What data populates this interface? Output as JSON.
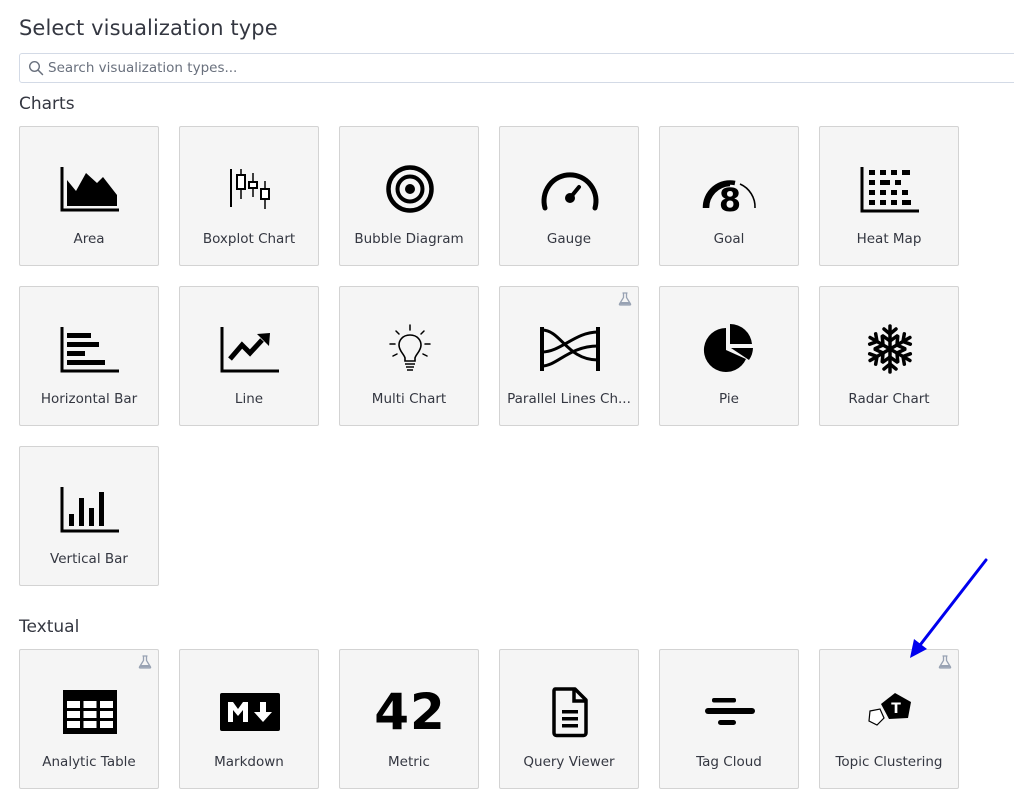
{
  "header": {
    "title": "Select visualization type"
  },
  "search": {
    "placeholder": "Search visualization types...",
    "value": ""
  },
  "sections": {
    "charts": {
      "title": "Charts",
      "tiles": [
        {
          "label": "Area",
          "icon": "area-chart-icon"
        },
        {
          "label": "Boxplot Chart",
          "icon": "boxplot-chart-icon"
        },
        {
          "label": "Bubble Diagram",
          "icon": "bubble-diagram-icon"
        },
        {
          "label": "Gauge",
          "icon": "gauge-icon"
        },
        {
          "label": "Goal",
          "icon": "goal-icon",
          "glyph": "8"
        },
        {
          "label": "Heat Map",
          "icon": "heat-map-icon"
        },
        {
          "label": "Horizontal Bar",
          "icon": "horizontal-bar-icon"
        },
        {
          "label": "Line",
          "icon": "line-chart-icon"
        },
        {
          "label": "Multi Chart",
          "icon": "lightbulb-icon"
        },
        {
          "label": "Parallel Lines Ch...",
          "icon": "parallel-lines-icon",
          "experimental": true
        },
        {
          "label": "Pie",
          "icon": "pie-chart-icon"
        },
        {
          "label": "Radar Chart",
          "icon": "snowflake-icon"
        },
        {
          "label": "Vertical Bar",
          "icon": "vertical-bar-icon"
        }
      ]
    },
    "textual": {
      "title": "Textual",
      "tiles": [
        {
          "label": "Analytic Table",
          "icon": "table-icon",
          "experimental": true
        },
        {
          "label": "Markdown",
          "icon": "markdown-icon"
        },
        {
          "label": "Metric",
          "icon": "metric-icon",
          "glyph": "42"
        },
        {
          "label": "Query Viewer",
          "icon": "document-icon"
        },
        {
          "label": "Tag Cloud",
          "icon": "tag-cloud-icon"
        },
        {
          "label": "Topic Clustering",
          "icon": "topic-clustering-icon",
          "experimental": true,
          "glyph": "T"
        }
      ]
    }
  },
  "colors": {
    "tile_background": "#f5f5f5",
    "tile_border": "#d3d3d3",
    "text": "#343741",
    "annotation_arrow": "#0000ee",
    "beta_badge": "#98a2b3"
  }
}
